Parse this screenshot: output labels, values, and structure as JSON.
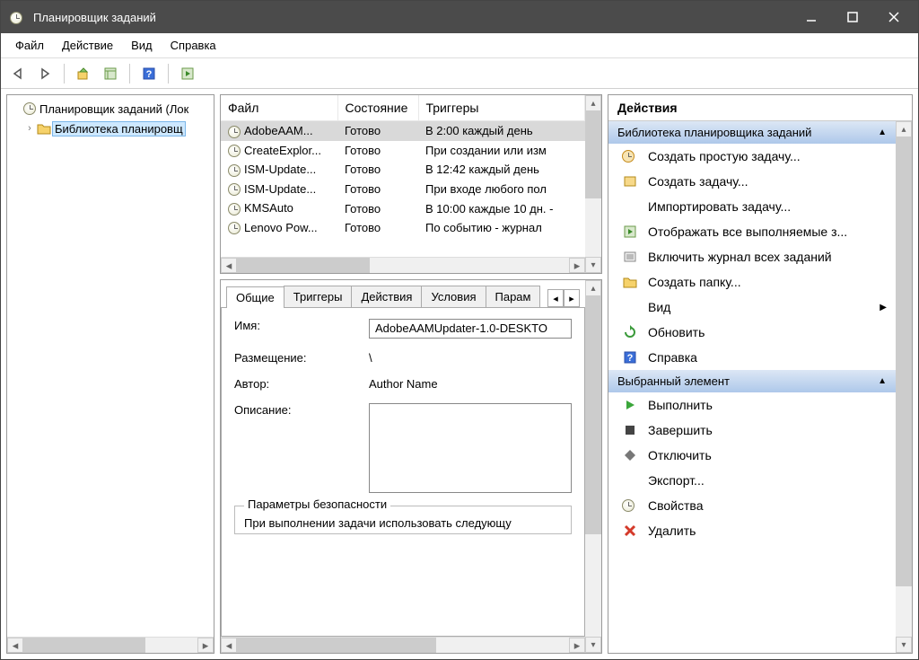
{
  "window": {
    "title": "Планировщик заданий"
  },
  "menu": {
    "file": "Файл",
    "action": "Действие",
    "view": "Вид",
    "help": "Справка"
  },
  "tree": {
    "root": "Планировщик заданий (Лок",
    "library": "Библиотека планировщ"
  },
  "task_table": {
    "col_file": "Файл",
    "col_state": "Состояние",
    "col_triggers": "Триггеры",
    "rows": [
      {
        "file": "AdobeAAM...",
        "state": "Готово",
        "trigger": "В 2:00 каждый день"
      },
      {
        "file": "CreateExplor...",
        "state": "Готово",
        "trigger": "При создании или изм"
      },
      {
        "file": "ISM-Update...",
        "state": "Готово",
        "trigger": "В 12:42 каждый день"
      },
      {
        "file": "ISM-Update...",
        "state": "Готово",
        "trigger": "При входе любого пол"
      },
      {
        "file": "KMSAuto",
        "state": "Готово",
        "trigger": "В 10:00 каждые 10 дн. -"
      },
      {
        "file": "Lenovo Pow...",
        "state": "Готово",
        "trigger": "По событию - журнал"
      }
    ]
  },
  "details": {
    "tabs": {
      "general": "Общие",
      "triggers": "Триггеры",
      "actions": "Действия",
      "conditions": "Условия",
      "params": "Парам"
    },
    "name_label": "Имя:",
    "name_value": "AdobeAAMUpdater-1.0-DESKTO",
    "location_label": "Размещение:",
    "location_value": "\\",
    "author_label": "Автор:",
    "author_value": "Author Name",
    "description_label": "Описание:",
    "security_legend": "Параметры безопасности",
    "security_text": "При выполнении задачи использовать следующу"
  },
  "actions": {
    "header": "Действия",
    "group_library": "Библиотека планировщика заданий",
    "create_simple": "Создать простую задачу...",
    "create_task": "Создать задачу...",
    "import_task": "Импортировать задачу...",
    "show_running": "Отображать все выполняемые з...",
    "enable_history": "Включить журнал всех заданий",
    "new_folder": "Создать папку...",
    "view": "Вид",
    "refresh": "Обновить",
    "help": "Справка",
    "group_selected": "Выбранный элемент",
    "run": "Выполнить",
    "end": "Завершить",
    "disable": "Отключить",
    "export": "Экспорт...",
    "properties": "Свойства",
    "delete": "Удалить"
  }
}
